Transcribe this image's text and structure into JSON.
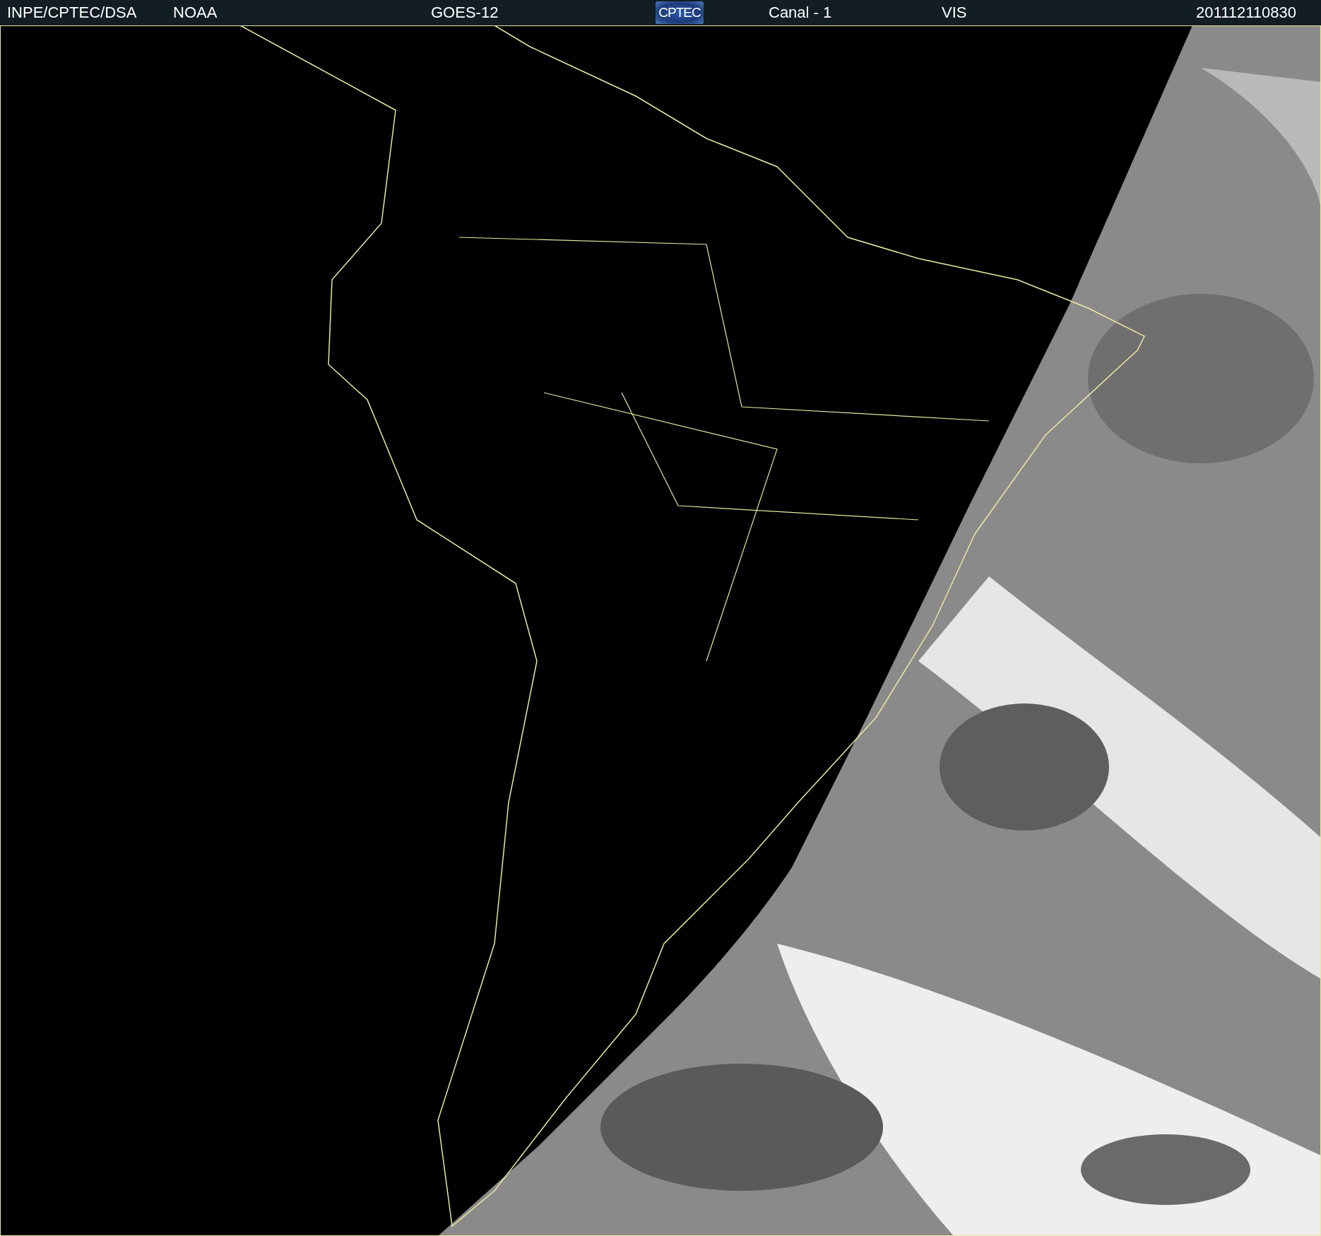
{
  "header": {
    "institution": "INPE/CPTEC/DSA",
    "agency": "NOAA",
    "satellite": "GOES-12",
    "logo": "CPTEC",
    "channel": "Canal - 1",
    "band": "VIS",
    "timestamp": "201112110830"
  }
}
